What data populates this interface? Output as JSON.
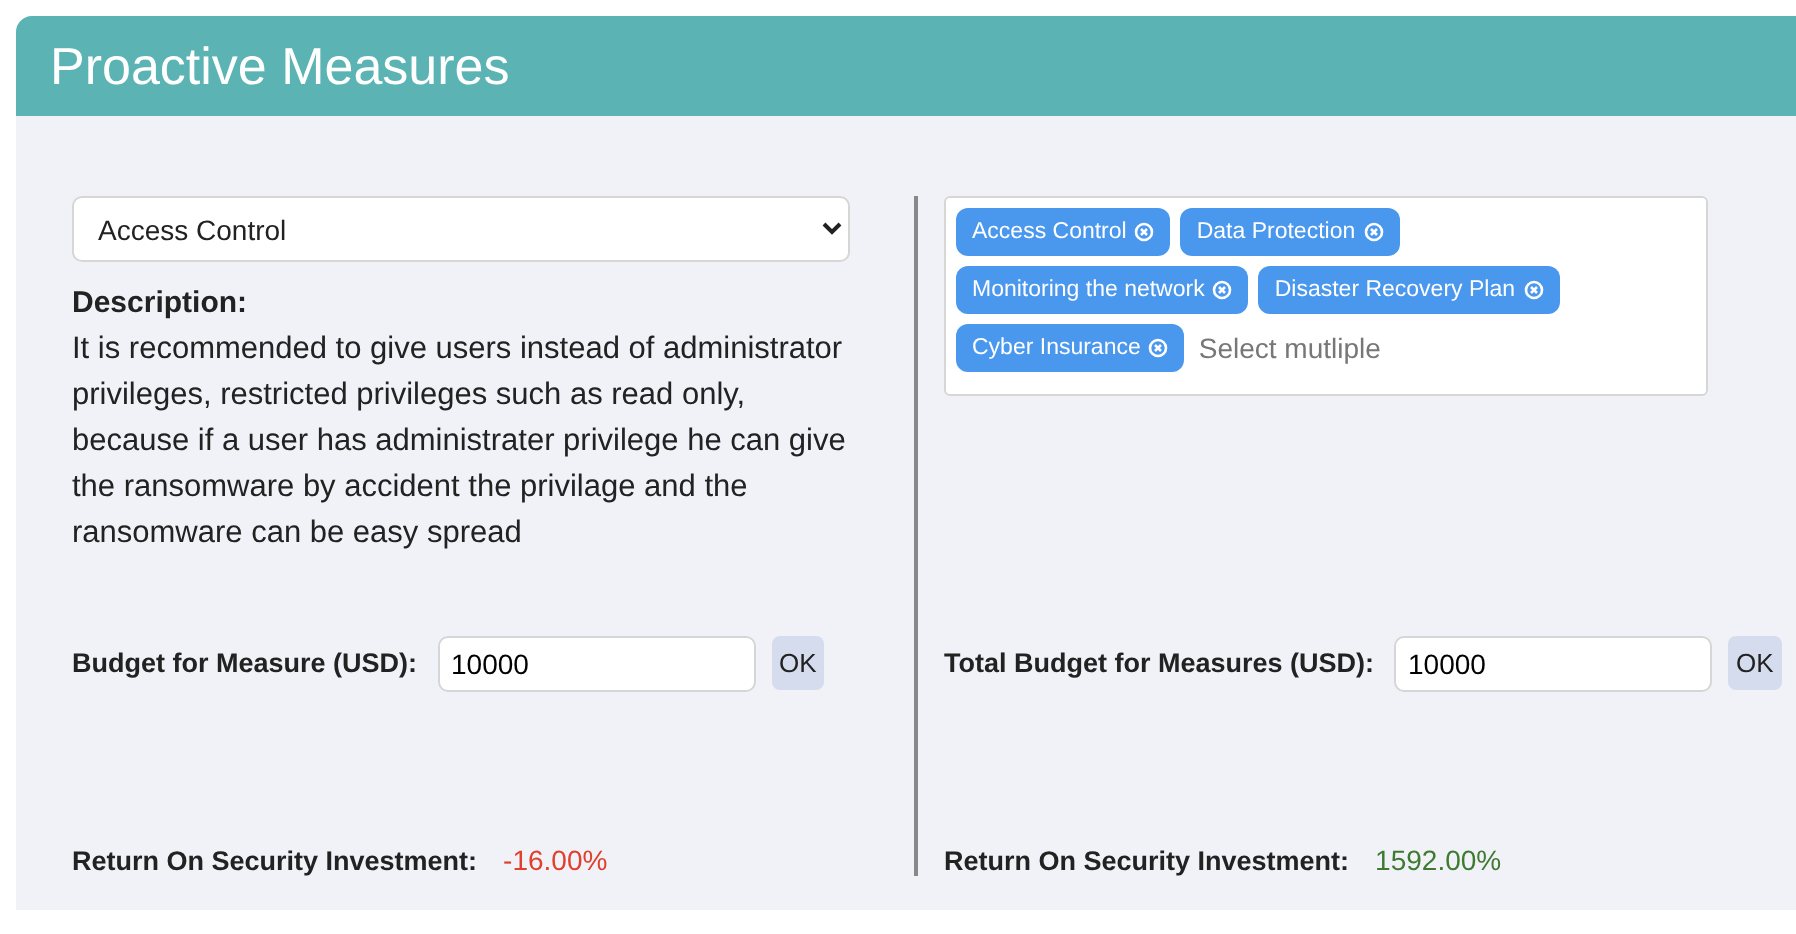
{
  "header": {
    "title": "Proactive Measures"
  },
  "measure_select": {
    "value": "Access Control"
  },
  "description": {
    "heading": "Description:",
    "text": "It is recommended to give users instead of administrator privileges, restricted privileges such as read only, because if a user has administrater privilege he can give the ransomware by accident the privilage and the ransomware can be easy spread"
  },
  "budget": {
    "label": "Budget for Measure (USD):",
    "value": "10000",
    "button": "OK"
  },
  "roi": {
    "label": "Return On Security Investment:",
    "value": "-16.00%",
    "negative": true
  },
  "multiselect": {
    "tags": [
      {
        "label": "Access Control"
      },
      {
        "label": "Data Protection"
      },
      {
        "label": "Monitoring the network"
      },
      {
        "label": "Disaster Recovery Plan"
      },
      {
        "label": "Cyber Insurance"
      }
    ],
    "placeholder": "Select mutliple"
  },
  "total_budget": {
    "label": "Total Budget for Measures (USD):",
    "value": "10000",
    "button": "OK"
  },
  "total_roi": {
    "label": "Return On Security Investment:",
    "value": "1592.00%",
    "negative": false
  }
}
